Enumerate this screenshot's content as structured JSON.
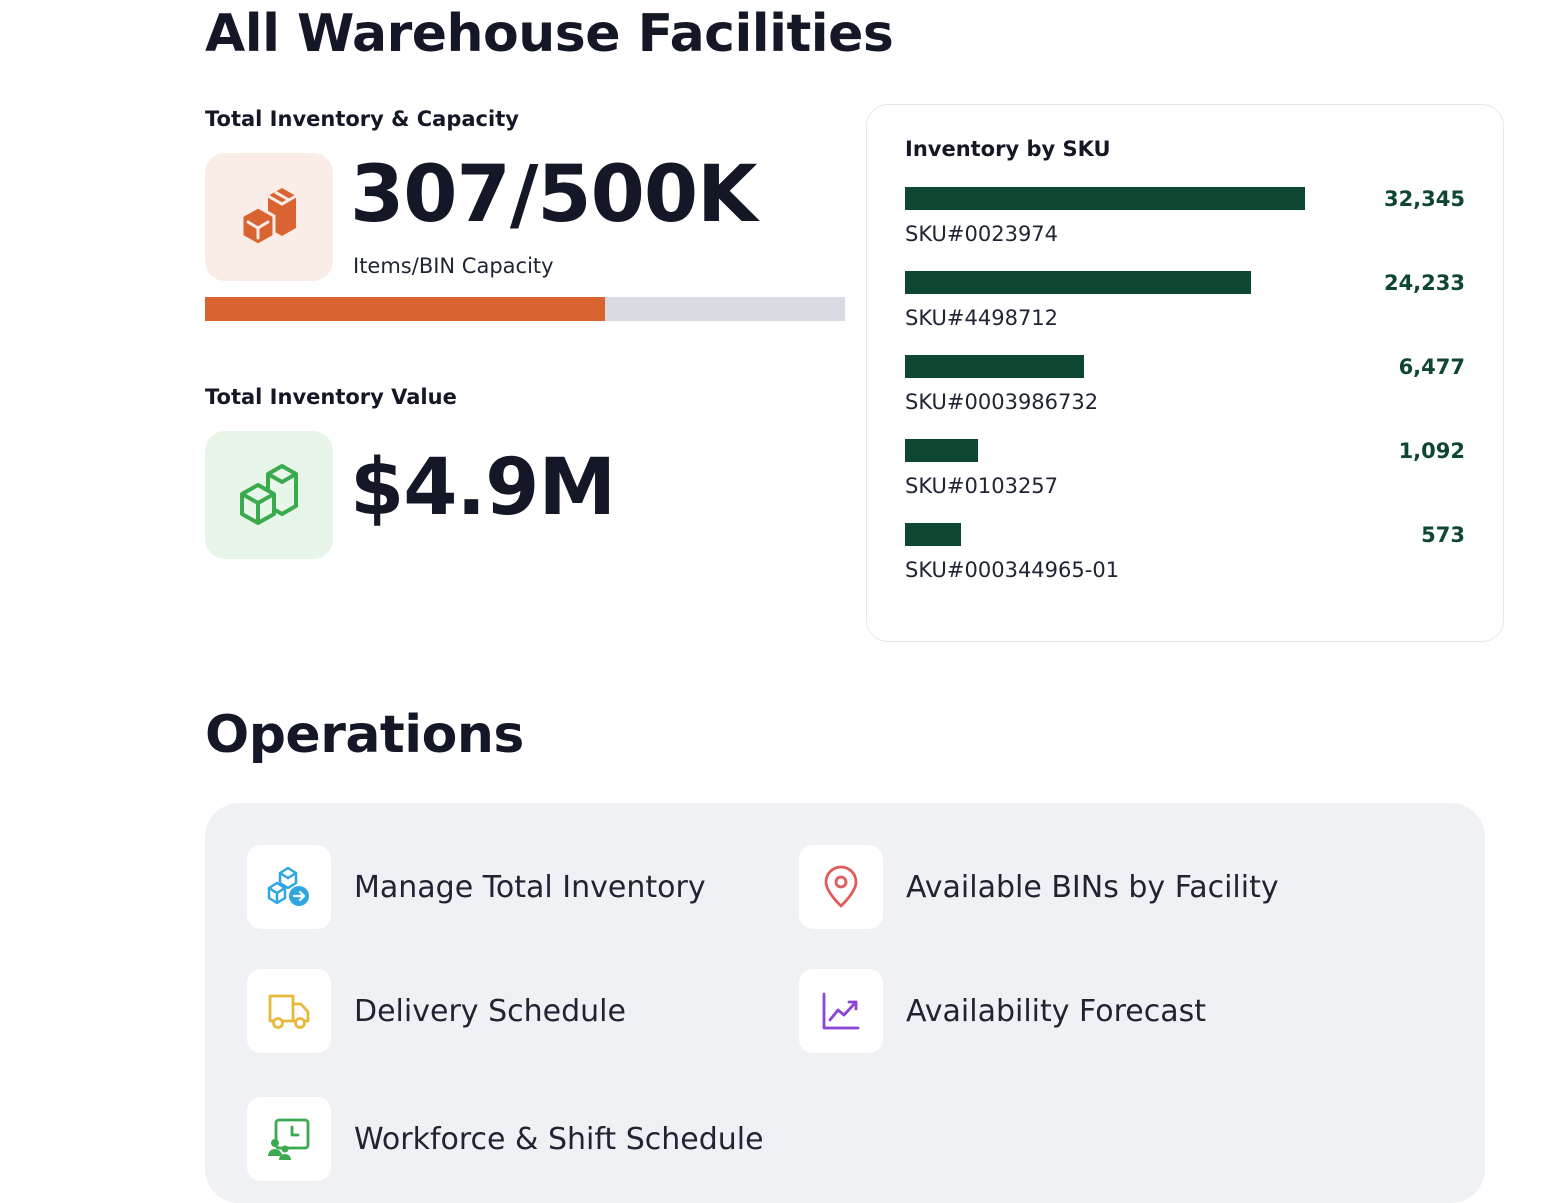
{
  "header": {
    "title": "All Warehouse Facilities"
  },
  "capacity": {
    "label": "Total Inventory & Capacity",
    "value": "307/500K",
    "sublabel": "Items/BIN Capacity",
    "fill_fraction": 0.625,
    "icon": "boxes-icon",
    "accent": "#d96331",
    "tile_bg": "#faede8"
  },
  "inventory_value": {
    "label": "Total Inventory Value",
    "value": "$4.9M",
    "icon": "boxes-icon",
    "accent": "#3aaa4e",
    "tile_bg": "#e8f6ea"
  },
  "sku_card": {
    "title": "Inventory by SKU",
    "bar_color": "#0e4731",
    "items": [
      {
        "sku": "SKU#0023974",
        "value": "32,345",
        "amount": 32345
      },
      {
        "sku": "SKU#4498712",
        "value": "24,233",
        "amount": 24233
      },
      {
        "sku": "SKU#0003986732",
        "value": "6,477",
        "amount": 6477
      },
      {
        "sku": "SKU#0103257",
        "value": "1,092",
        "amount": 1092
      },
      {
        "sku": "SKU#000344965-01",
        "value": "573",
        "amount": 573
      }
    ]
  },
  "operations": {
    "title": "Operations",
    "items": [
      {
        "label": "Manage Total Inventory",
        "icon": "inventory-transfer-icon",
        "color": "#2ea7e0"
      },
      {
        "label": "Available BINs by Facility",
        "icon": "location-pin-icon",
        "color": "#e25b5b"
      },
      {
        "label": "Delivery Schedule",
        "icon": "truck-icon",
        "color": "#e6b93a"
      },
      {
        "label": "Availability Forecast",
        "icon": "trend-chart-icon",
        "color": "#8a44d6"
      },
      {
        "label": "Workforce & Shift Schedule",
        "icon": "shift-schedule-icon",
        "color": "#3aaa4e"
      }
    ]
  }
}
